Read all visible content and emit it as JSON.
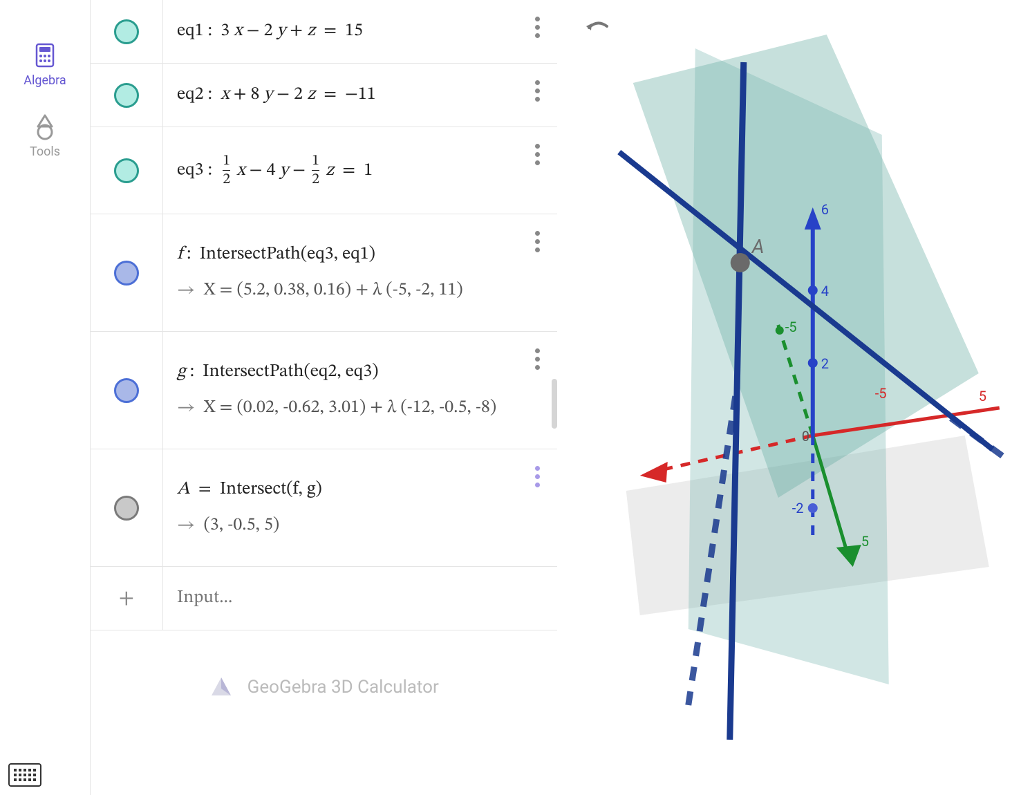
{
  "nav": {
    "algebra": "Algebra",
    "tools": "Tools"
  },
  "rows": {
    "eq1": {
      "label": "eq1",
      "expr_html": "3 <span class='mvar'>x</span> − 2 <span class='mvar'>y</span> + <span class='mvar'>z</span>&nbsp; =&nbsp; 15"
    },
    "eq2": {
      "label": "eq2",
      "expr_html": "<span class='mvar'>x</span> + 8 <span class='mvar'>y</span> − 2 <span class='mvar'>z</span>&nbsp; =&nbsp; −11"
    },
    "eq3": {
      "label": "eq3",
      "expr_html": "<span class='frac'><span class='num'>1</span><span class='den'>2</span></span>&nbsp;<span class='mvar'>x</span> − 4 <span class='mvar'>y</span> − <span class='frac'><span class='num'>1</span><span class='den'>2</span></span>&nbsp;<span class='mvar'>z</span>&nbsp; =&nbsp; 1"
    },
    "f": {
      "label": "f",
      "cmd": "IntersectPath(eq3, eq1)",
      "result": "X = (5.2, 0.38, 0.16) + λ (-5, -2, 11)"
    },
    "g": {
      "label": "g",
      "cmd": "IntersectPath(eq2, eq3)",
      "result": "X = (0.02, -0.62, 3.01) + λ (-12, -0.5, -8)"
    },
    "A": {
      "label": "A",
      "cmd": "Intersect(f, g)",
      "result": "(3, -0.5, 5)"
    }
  },
  "input": {
    "placeholder": "Input..."
  },
  "footer": {
    "text": "GeoGebra 3D Calculator"
  },
  "graphics": {
    "axis_ticks": {
      "z": [
        "6",
        "4",
        "2",
        "-2"
      ],
      "y": [
        "-5",
        "5"
      ],
      "x": [
        "-5",
        "5"
      ]
    },
    "point_label": "A"
  }
}
